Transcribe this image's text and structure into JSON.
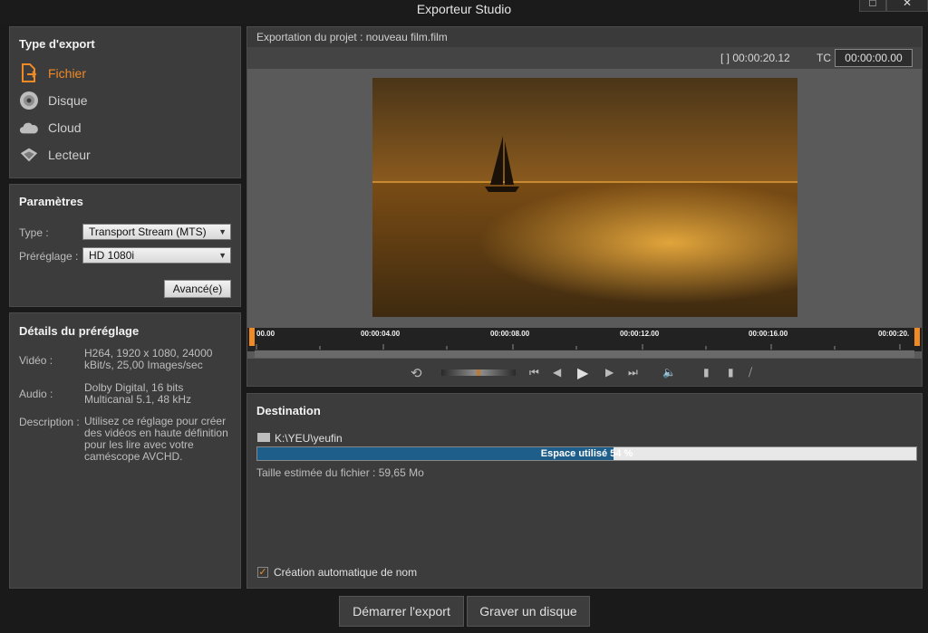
{
  "window": {
    "title": "Exporteur Studio",
    "maximize_glyph": "□",
    "close_glyph": "✕"
  },
  "export_type": {
    "heading": "Type d'export",
    "items": [
      {
        "label": "Fichier",
        "icon": "file-export-icon",
        "active": true
      },
      {
        "label": "Disque",
        "icon": "disc-icon",
        "active": false
      },
      {
        "label": "Cloud",
        "icon": "cloud-icon",
        "active": false
      },
      {
        "label": "Lecteur",
        "icon": "device-icon",
        "active": false
      }
    ]
  },
  "params": {
    "heading": "Paramètres",
    "type_label": "Type :",
    "type_value": "Transport Stream (MTS)",
    "preset_label": "Préréglage :",
    "preset_value": "HD 1080i",
    "advanced_label": "Avancé(e)"
  },
  "details": {
    "heading": "Détails du préréglage",
    "video_label": "Vidéo :",
    "video_value": "H264, 1920 x 1080, 24000 kBit/s, 25,00 Images/sec",
    "audio_label": "Audio :",
    "audio_value": "Dolby Digital, 16 bits Multicanal 5.1, 48 kHz",
    "desc_label": "Description :",
    "desc_value": "Utilisez ce réglage pour créer des vidéos en haute définition pour les lire avec votre caméscope AVCHD."
  },
  "preview": {
    "project_label": "Exportation du projet : nouveau film.film",
    "duration_text": "[ ] 00:00:20.12",
    "tc_label": "TC",
    "tc_value": "00:00:00.00",
    "timeline_ticks": [
      "00.00",
      "00:00:04.00",
      "00:00:08.00",
      "00:00:12.00",
      "00:00:16.00",
      "00:00:20."
    ]
  },
  "destination": {
    "heading": "Destination",
    "path": "K:\\YEU\\yeufin",
    "space_text": "Espace utilisé 54 %",
    "space_fraction": 0.54,
    "estimated_size": "Taille estimée du fichier : 59,65 Mo",
    "auto_name_label": "Création automatique de nom",
    "auto_name_checked": true
  },
  "actions": {
    "start_label": "Démarrer l'export",
    "burn_label": "Graver un disque"
  },
  "colors": {
    "accent": "#f08a24",
    "panel": "#3c3c3c",
    "progress": "#1e5e8a"
  }
}
